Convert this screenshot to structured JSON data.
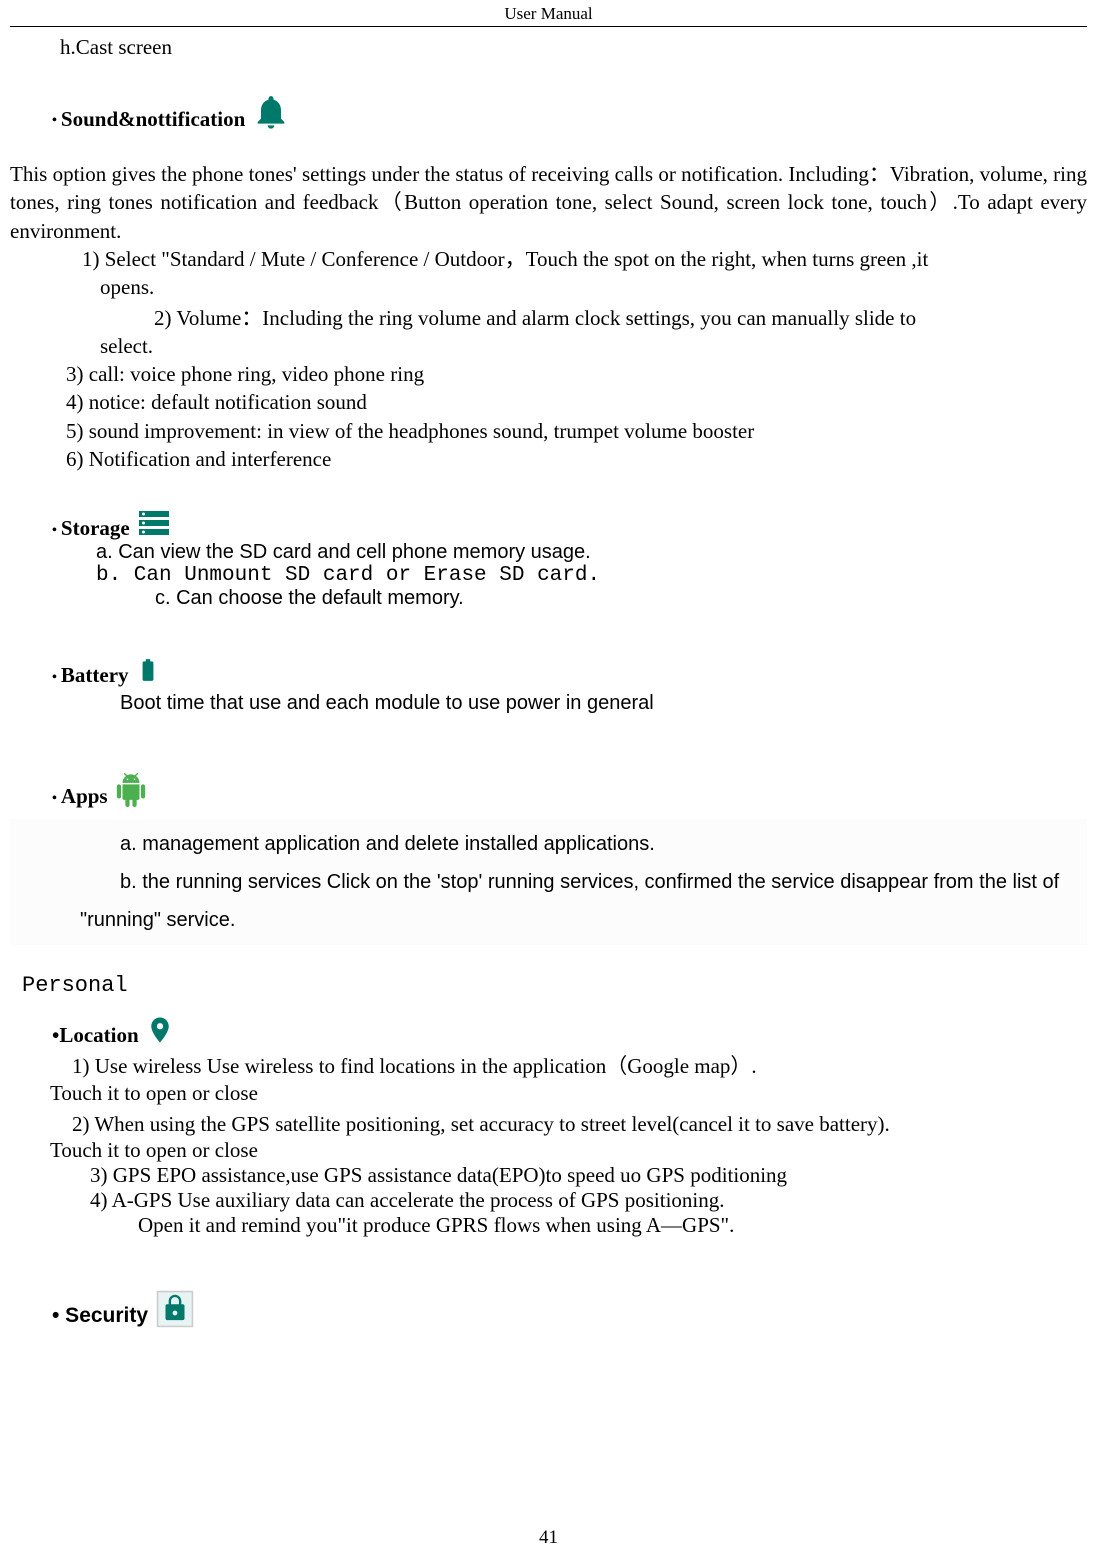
{
  "header": "User    Manual",
  "cast": "h.Cast screen",
  "sound_title": "Sound&nottification",
  "sound_para": "       This option gives the phone tones' settings under the status of receiving calls or notification. Including：Vibration, volume, ring tones, ring tones notification and feedback（Button operation tone, select Sound, screen lock tone, touch）.To adapt every environment.",
  "sound_l1a": "1) Select  \"Standard / Mute / Conference / Outdoor，Touch the spot on the right, when turns green ,it",
  "sound_l1b": "opens.",
  "sound_l2a": "2) Volume：Including the ring volume and alarm clock settings, you can manually slide to",
  "sound_l2b": "select.",
  "sound_l3": "3) call: voice phone ring, video phone ring",
  "sound_l4": "4) notice: default notification sound",
  "sound_l5": "5) sound improvement: in view of the headphones sound, trumpet volume booster",
  "sound_l6": "6) Notification and interference",
  "storage_title": "Storage",
  "storage_a": "a.   Can view the SD card and cell phone memory usage.",
  "storage_b": "b. Can Unmount SD card or Erase SD card.",
  "storage_c": "c. Can choose the default memory.",
  "battery_title": "Battery",
  "battery_line": "Boot time that use and each module to use power in general",
  "apps_title": "Apps",
  "apps_a": "a. management application and delete installed applications.",
  "apps_b": "b. the running services Click on the 'stop' running services, confirmed the service disappear from the list of",
  "apps_b2": "\"running\" service.",
  "personal": "Personal",
  "location_title": "•Location",
  "loc_1": "1) Use wireless    Use wireless to find locations in the application（Google map）.",
  "loc_close1": "Touch it to open or close",
  "loc_2": "2) When using the GPS satellite positioning, set accuracy to street level(cancel it to save battery).",
  "loc_close2": "Touch it to open or close",
  "loc_3": "3) GPS EPO assistance,use GPS assistance data(EPO)to speed uo GPS poditioning",
  "loc_4": "4) A-GPS      Use auxiliary data can accelerate the process of GPS positioning.",
  "loc_4b": "Open it and remind you\"it produce GPRS flows when using A—GPS\".",
  "security_title": "• Security",
  "pagenum": "41"
}
